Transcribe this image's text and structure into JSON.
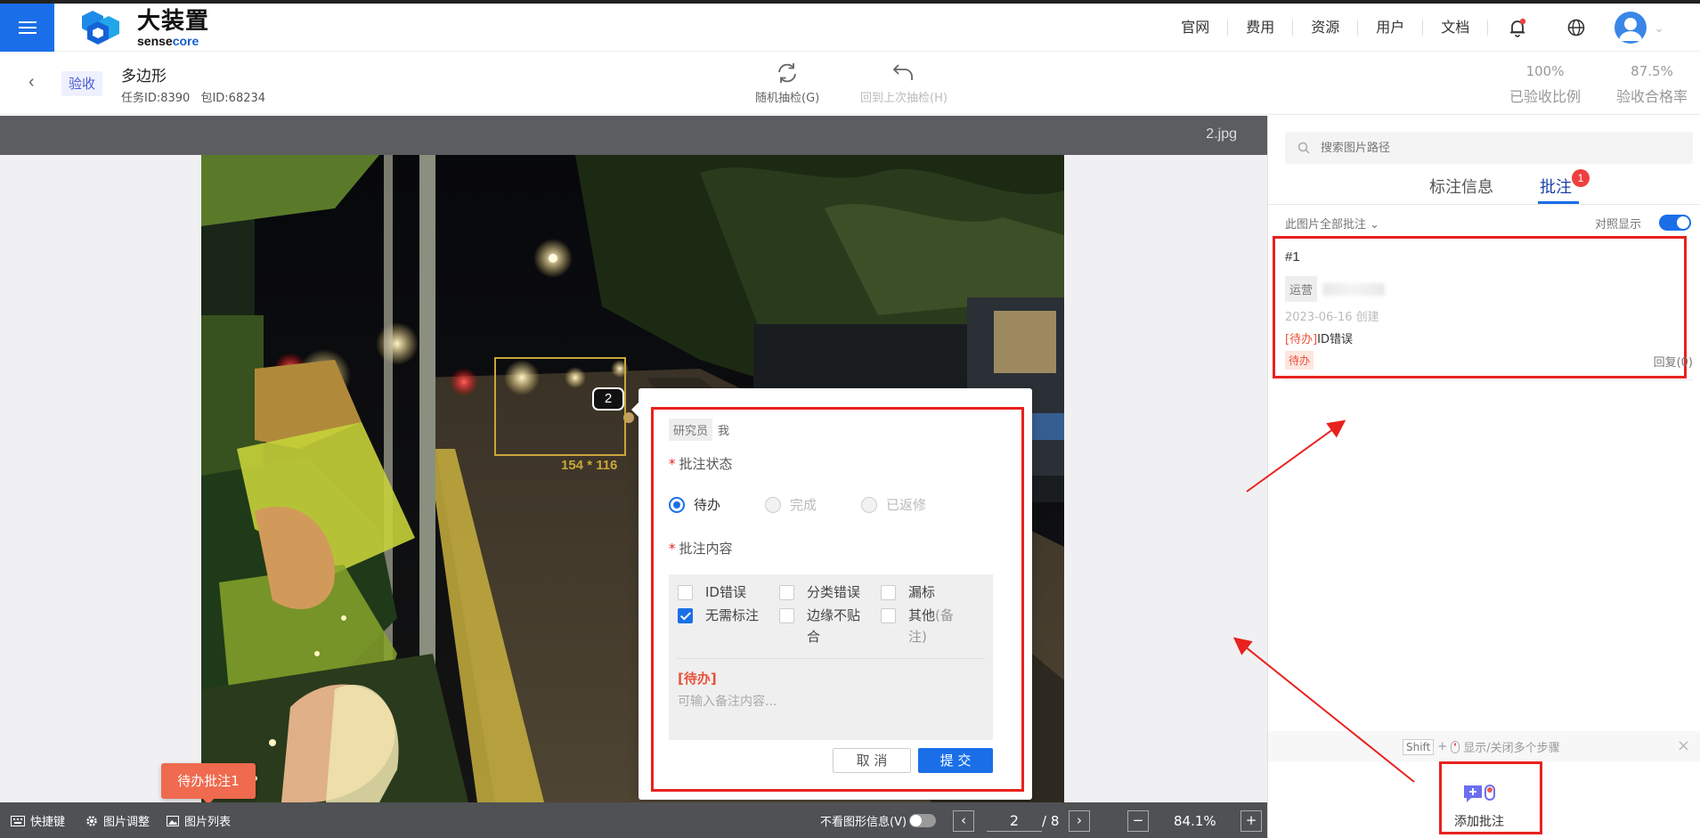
{
  "app": {
    "logo_cn": "大装置",
    "logo_en_prefix": "sense",
    "logo_en_suffix": "core"
  },
  "topnav": {
    "items": [
      "官网",
      "费用",
      "资源",
      "用户",
      "文档"
    ]
  },
  "task": {
    "stage": "验收",
    "title": "多边形",
    "task_id": "任务ID:8390",
    "package_id": "包ID:68234",
    "random_check": "随机抽检(G)",
    "back_check": "回到上次抽检(H)",
    "accepted_ratio_value": "100%",
    "accepted_ratio_label": "已验收比例",
    "pass_rate_value": "87.5%",
    "pass_rate_label": "验收合格率"
  },
  "canvas": {
    "file_name": "2.jpg",
    "bbox_number": "2",
    "bbox_size": "154 * 116",
    "pending_chip": "待办批注1"
  },
  "popover": {
    "role_tag": "研究员",
    "role_user": "我",
    "status_label": "批注状态",
    "status_options": [
      "待办",
      "完成",
      "已返修"
    ],
    "content_label": "批注内容",
    "checks": [
      "ID错误",
      "分类错误",
      "漏标",
      "无需标注",
      "边缘不贴合",
      "其他"
    ],
    "check_other_note": "(备注)",
    "note_status": "[待办]",
    "note_placeholder": "可输入备注内容...",
    "cancel": "取 消",
    "submit": "提 交"
  },
  "bottombar": {
    "shortcuts": "快捷键",
    "image_adjust": "图片调整",
    "image_list": "图片列表",
    "hide_shape_info": "不看图形信息(V)",
    "page_current": "2",
    "page_total": "/ 8",
    "zoom": "84.1%",
    "zoom_out": "−",
    "zoom_in": "+"
  },
  "right_panel": {
    "search_placeholder": "搜索图片路径",
    "tab_info": "标注信息",
    "tab_notes": "批注",
    "notes_badge": "1",
    "filter": "此图片全部批注",
    "compare_label": "对照显示",
    "note": {
      "id": "#1",
      "role": "运营",
      "date": "2023-06-16 创建",
      "status_prefix": "[待办]",
      "text": "ID错误",
      "status_tag": "待办",
      "reply": "回复(0)"
    },
    "hint_key": "Shift",
    "hint_text": "显示/关闭多个步骤",
    "add_note": "添加批注"
  },
  "colors": {
    "primary": "#1a6fe8",
    "highlight": "#e8221e",
    "pending": "#ef6a4e"
  }
}
